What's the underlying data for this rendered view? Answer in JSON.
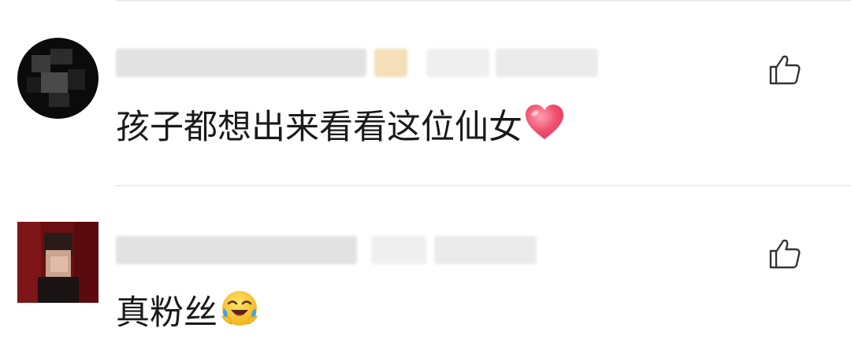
{
  "comments": [
    {
      "text": "孩子都想出来看看这位仙女",
      "emoji": "heart-emoji"
    },
    {
      "text": "真粉丝",
      "emoji": "rofl-emoji"
    }
  ],
  "icons": {
    "like": "thumbs-up-icon"
  },
  "colors": {
    "text": "#1a1a1a",
    "icon": "#333333",
    "divider": "#ececec",
    "heart": "#f0506e",
    "emoji_face": "#f7c31d"
  }
}
